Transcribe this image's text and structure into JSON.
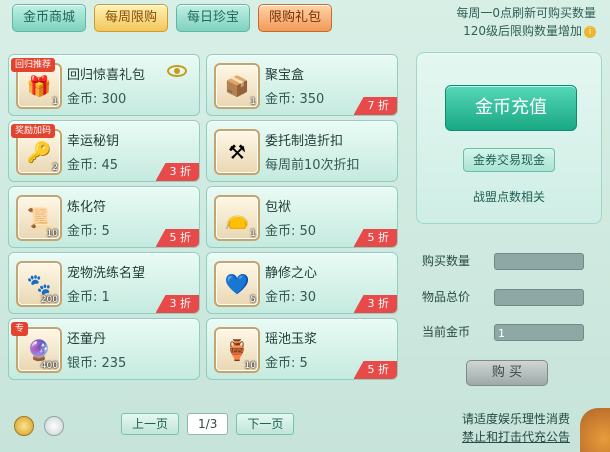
{
  "tabs": [
    {
      "label": "金币商城",
      "state": "normal"
    },
    {
      "label": "每周限购",
      "state": "active"
    },
    {
      "label": "每日珍宝",
      "state": "normal"
    },
    {
      "label": "限购礼包",
      "state": "gift"
    }
  ],
  "notice": {
    "line1": "每周一0点刷新可购买数量",
    "line2": "120级后限购数量增加",
    "info_icon": "i"
  },
  "items": [
    {
      "name": "回归惊喜礼包",
      "price": "金币: 300",
      "qty": "1",
      "ribbon": "回归推荐",
      "discount": "",
      "icon": "gift-chest-icon",
      "glyph": "🎁",
      "has_eye": true
    },
    {
      "name": "聚宝盒",
      "price": "金币: 350",
      "qty": "1",
      "ribbon": "",
      "discount": "7 折",
      "icon": "treasure-box-icon",
      "glyph": "📦",
      "has_eye": false
    },
    {
      "name": "幸运秘钥",
      "price": "金币: 45",
      "qty": "2",
      "ribbon": "奖励加码",
      "discount": "3 折",
      "icon": "key-icon",
      "glyph": "🔑",
      "has_eye": false
    },
    {
      "name": "委托制造折扣",
      "price": "每周前10次折扣",
      "qty": "",
      "ribbon": "",
      "discount": "",
      "icon": "anvil-icon",
      "glyph": "⚒",
      "has_eye": false
    },
    {
      "name": "炼化符",
      "price": "金币: 5",
      "qty": "10",
      "ribbon": "",
      "discount": "5 折",
      "icon": "talisman-icon",
      "glyph": "📜",
      "has_eye": false
    },
    {
      "name": "包袱",
      "price": "金币: 50",
      "qty": "1",
      "ribbon": "",
      "discount": "5 折",
      "icon": "bag-icon",
      "glyph": "👝",
      "has_eye": false
    },
    {
      "name": "宠物洗练名望",
      "price": "金币: 1",
      "qty": "200",
      "ribbon": "",
      "discount": "3 折",
      "icon": "paw-badge-icon",
      "glyph": "🐾",
      "has_eye": false
    },
    {
      "name": "静修之心",
      "price": "金币: 30",
      "qty": "5",
      "ribbon": "",
      "discount": "3 折",
      "icon": "heart-gem-icon",
      "glyph": "💙",
      "has_eye": false
    },
    {
      "name": "还童丹",
      "price": "银币: 235",
      "qty": "400",
      "ribbon": "专",
      "discount": "",
      "icon": "pill-icon",
      "glyph": "🔮",
      "has_eye": false
    },
    {
      "name": "瑶池玉浆",
      "price": "金币: 5",
      "qty": "10",
      "ribbon": "",
      "discount": "5 折",
      "icon": "jade-jar-icon",
      "glyph": "🏺",
      "has_eye": false
    }
  ],
  "right_panel": {
    "topup_label": "金币充值",
    "exchange_label": "金券交易现金",
    "alliance_label": "战盟点数相关"
  },
  "purchase": {
    "qty_label": "购买数量",
    "total_label": "物品总价",
    "current_label": "当前金币",
    "qty_value": "",
    "total_value": "",
    "current_value": "1",
    "buy_label": "购 买"
  },
  "pager": {
    "prev_label": "上一页",
    "page": "1/3",
    "next_label": "下一页"
  },
  "footer": {
    "line1": "请适度娱乐理性消费",
    "line2": "禁止和打击代充公告"
  }
}
